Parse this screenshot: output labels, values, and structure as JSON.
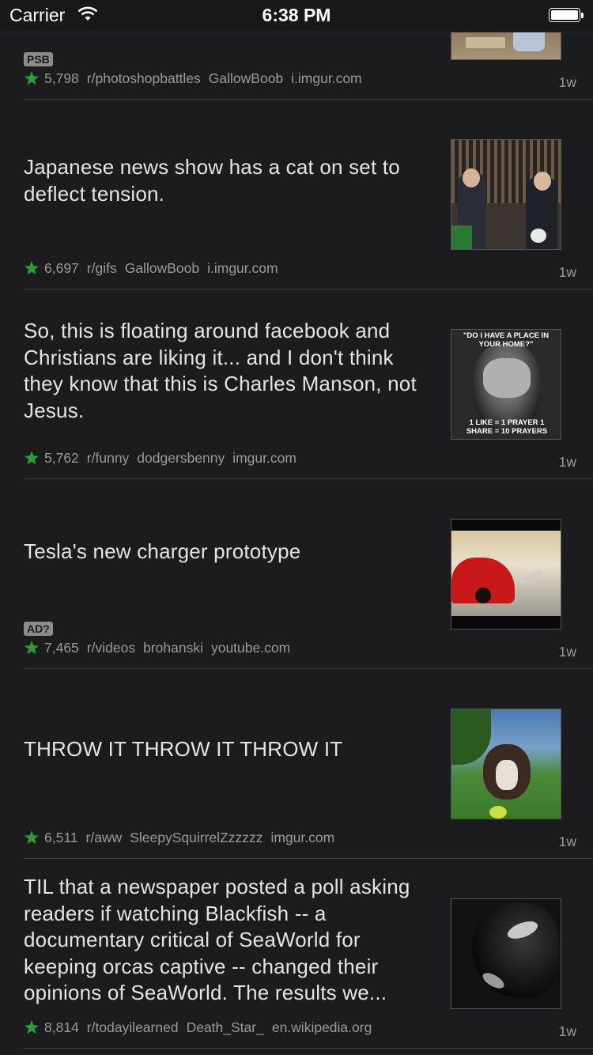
{
  "status_bar": {
    "carrier": "Carrier",
    "time": "6:38 PM"
  },
  "posts": [
    {
      "title": "",
      "flair": "PSB",
      "score": "5,798",
      "subreddit": "r/photoshopbattles",
      "author": "GallowBoob",
      "domain": "i.imgur.com",
      "age": "1w",
      "thumbnail": "photo-thumbnail"
    },
    {
      "title": "Japanese news show has a cat on set to deflect tension.",
      "score": "6,697",
      "subreddit": "r/gifs",
      "author": "GallowBoob",
      "domain": "i.imgur.com",
      "age": "1w",
      "thumbnail": "news-show-cat-thumbnail"
    },
    {
      "title": "So, this is floating around facebook and Christians are liking it... and I don't think they know that this is Charles Manson, not Jesus.",
      "score": "5,762",
      "subreddit": "r/funny",
      "author": "dodgersbenny",
      "domain": "imgur.com",
      "age": "1w",
      "thumbnail": "meme-thumbnail",
      "thumb_text_top": "\"DO I HAVE A PLACE IN YOUR HOME?\"",
      "thumb_text_bottom": "1 LIKE = 1 PRAYER 1 SHARE = 10 PRAYERS"
    },
    {
      "title": "Tesla's new charger prototype",
      "flair": "AD?",
      "score": "7,465",
      "subreddit": "r/videos",
      "author": "brohanski",
      "domain": "youtube.com",
      "age": "1w",
      "thumbnail": "video-thumbnail"
    },
    {
      "title": "THROW IT THROW IT THROW IT",
      "score": "6,511",
      "subreddit": "r/aww",
      "author": "SleepySquirrelZzzzzz",
      "domain": "imgur.com",
      "age": "1w",
      "thumbnail": "dog-thumbnail"
    },
    {
      "title": "TIL that a newspaper posted a poll asking readers if watching Blackfish -- a documentary critical of SeaWorld for keeping orcas captive -- changed their opinions of SeaWorld. The results we...",
      "score": "8,814",
      "subreddit": "r/todayilearned",
      "author": "Death_Star_",
      "domain": "en.wikipedia.org",
      "age": "1w",
      "thumbnail": "orca-thumbnail"
    }
  ],
  "colors": {
    "background": "#1c1c1e",
    "star": "#2e9a3a",
    "meta": "#9a9a9a",
    "divider": "#3d3d3d"
  }
}
